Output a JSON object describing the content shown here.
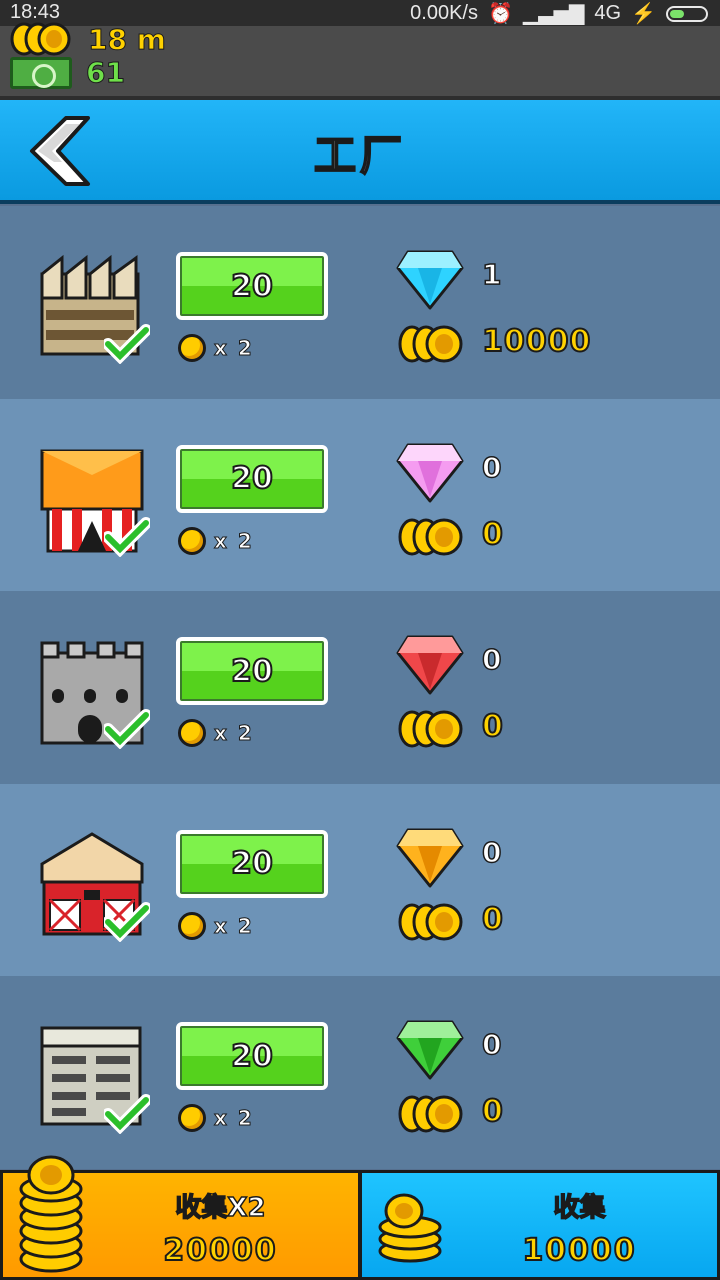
{
  "status_bar": {
    "time": "18:43",
    "network_speed": "0.00K/s",
    "network_type": "4G"
  },
  "resources": {
    "coins": "18 m",
    "cash": "61"
  },
  "header": {
    "title": "工厂"
  },
  "factories": [
    {
      "building": "warehouse-building-icon",
      "upgrade_cost": "20",
      "multiplier": "x 2",
      "gem_color": "#2ed3ff",
      "gem_name": "blue-diamond-icon",
      "gem_count": "1",
      "coin_output": "10000"
    },
    {
      "building": "circus-tent-icon",
      "upgrade_cost": "20",
      "multiplier": "x 2",
      "gem_color": "#f59cf0",
      "gem_name": "pink-diamond-icon",
      "gem_count": "0",
      "coin_output": "0"
    },
    {
      "building": "castle-icon",
      "upgrade_cost": "20",
      "multiplier": "x 2",
      "gem_color": "#f0474a",
      "gem_name": "red-diamond-icon",
      "gem_count": "0",
      "coin_output": "0"
    },
    {
      "building": "barn-icon",
      "upgrade_cost": "20",
      "multiplier": "x 2",
      "gem_color": "#ffb21d",
      "gem_name": "orange-diamond-icon",
      "gem_count": "0",
      "coin_output": "0"
    },
    {
      "building": "office-building-icon",
      "upgrade_cost": "20",
      "multiplier": "x 2",
      "gem_color": "#3fcf3a",
      "gem_name": "green-diamond-icon",
      "gem_count": "0",
      "coin_output": "0"
    }
  ],
  "bottom": {
    "collect_x2_label": "收集X2",
    "collect_x2_amount": "20000",
    "collect_label": "收集",
    "collect_amount": "10000"
  }
}
